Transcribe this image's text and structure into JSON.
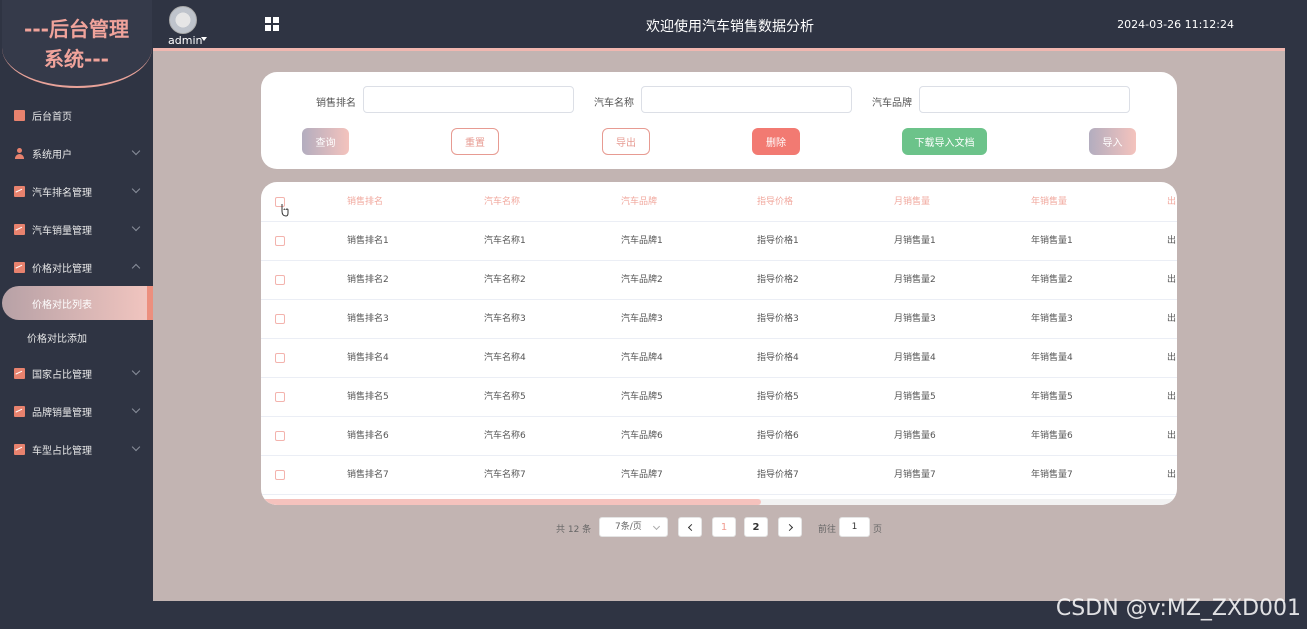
{
  "logo": {
    "line1": "---后台管理",
    "line2": "系统---"
  },
  "header": {
    "user": "admin",
    "title": "欢迎使用汽车销售数据分析",
    "datetime": "2024-03-26 11:12:24"
  },
  "sidebar": {
    "items": [
      {
        "label": "后台首页"
      },
      {
        "label": "系统用户"
      },
      {
        "label": "汽车排名管理"
      },
      {
        "label": "汽车销量管理"
      },
      {
        "label": "价格对比管理"
      },
      {
        "label": "国家占比管理"
      },
      {
        "label": "品牌销量管理"
      },
      {
        "label": "车型占比管理"
      }
    ],
    "sub_items": [
      {
        "label": "价格对比列表"
      },
      {
        "label": "价格对比添加"
      }
    ]
  },
  "search": {
    "rank_label": "销售排名",
    "rank_value": "",
    "name_label": "汽车名称",
    "name_value": "",
    "brand_label": "汽车品牌",
    "brand_value": "",
    "buttons": {
      "query": "查询",
      "reset": "重置",
      "export": "导出",
      "delete": "删除",
      "download": "下载导入文档",
      "import": "导入"
    }
  },
  "table": {
    "columns": [
      "销售排名",
      "汽车名称",
      "汽车品牌",
      "指导价格",
      "月销售量",
      "年销售量",
      "出"
    ],
    "rows": [
      [
        "销售排名1",
        "汽车名称1",
        "汽车品牌1",
        "指导价格1",
        "月销售量1",
        "年销售量1",
        "出"
      ],
      [
        "销售排名2",
        "汽车名称2",
        "汽车品牌2",
        "指导价格2",
        "月销售量2",
        "年销售量2",
        "出"
      ],
      [
        "销售排名3",
        "汽车名称3",
        "汽车品牌3",
        "指导价格3",
        "月销售量3",
        "年销售量3",
        "出"
      ],
      [
        "销售排名4",
        "汽车名称4",
        "汽车品牌4",
        "指导价格4",
        "月销售量4",
        "年销售量4",
        "出"
      ],
      [
        "销售排名5",
        "汽车名称5",
        "汽车品牌5",
        "指导价格5",
        "月销售量5",
        "年销售量5",
        "出"
      ],
      [
        "销售排名6",
        "汽车名称6",
        "汽车品牌6",
        "指导价格6",
        "月销售量6",
        "年销售量6",
        "出"
      ],
      [
        "销售排名7",
        "汽车名称7",
        "汽车品牌7",
        "指导价格7",
        "月销售量7",
        "年销售量7",
        "出"
      ]
    ]
  },
  "pagination": {
    "total": "共 12 条",
    "page_size": "7条/页",
    "pages": [
      "1",
      "2"
    ],
    "goto_label": "前往",
    "goto_value": "1",
    "page_suffix": "页"
  },
  "watermark": "CSDN @v:MZ_ZXD001",
  "colors": {
    "accent": "#f1a89e",
    "delete": "#f27a72",
    "download": "#6cc38a",
    "main_bg": "#c2b4b2",
    "sidebar_bg": "#2f3443"
  }
}
